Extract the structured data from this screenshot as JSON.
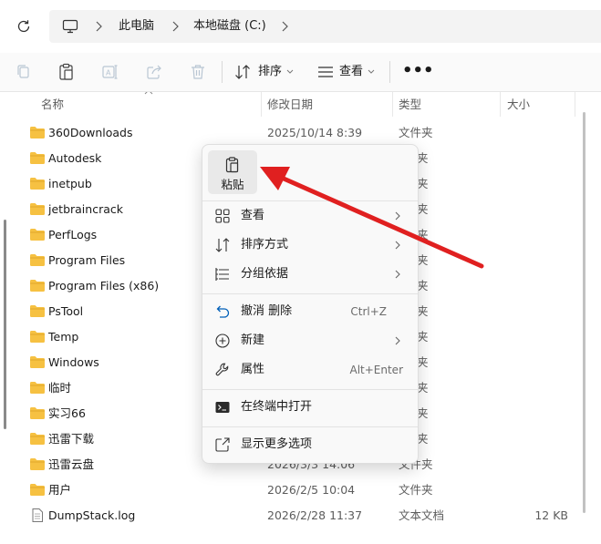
{
  "colors": {
    "folder": "#f6c142",
    "annotation_arrow": "#e02020",
    "accent": "#005fb8"
  },
  "breadcrumb": {
    "items": [
      "此电脑",
      "本地磁盘 (C:)"
    ]
  },
  "toolbar": {
    "sort_label": "排序",
    "view_label": "查看",
    "more_label": "•••"
  },
  "columns": {
    "name": "名称",
    "date": "修改日期",
    "type": "类型",
    "size": "大小"
  },
  "files": [
    {
      "name": "360Downloads",
      "date": "2025/10/14 8:39",
      "type": "文件夹",
      "size": "",
      "icon": "folder-icon"
    },
    {
      "name": "Autodesk",
      "date": "",
      "type": "夹",
      "size": "",
      "icon": "folder-icon"
    },
    {
      "name": "inetpub",
      "date": "",
      "type": "夹",
      "size": "",
      "icon": "folder-icon"
    },
    {
      "name": "jetbraincrack",
      "date": "",
      "type": "夹",
      "size": "",
      "icon": "folder-icon"
    },
    {
      "name": "PerfLogs",
      "date": "",
      "type": "夹",
      "size": "",
      "icon": "folder-icon"
    },
    {
      "name": "Program Files",
      "date": "",
      "type": "夹",
      "size": "",
      "icon": "folder-icon"
    },
    {
      "name": "Program Files (x86)",
      "date": "",
      "type": "夹",
      "size": "",
      "icon": "folder-icon"
    },
    {
      "name": "PsTool",
      "date": "",
      "type": "夹",
      "size": "",
      "icon": "folder-icon"
    },
    {
      "name": "Temp",
      "date": "",
      "type": "夹",
      "size": "",
      "icon": "folder-icon"
    },
    {
      "name": "Windows",
      "date": "",
      "type": "夹",
      "size": "",
      "icon": "folder-icon"
    },
    {
      "name": "临时",
      "date": "",
      "type": "夹",
      "size": "",
      "icon": "folder-icon"
    },
    {
      "name": "实习66",
      "date": "",
      "type": "夹",
      "size": "",
      "icon": "folder-icon"
    },
    {
      "name": "迅雷下载",
      "date": "",
      "type": "夹",
      "size": "",
      "icon": "folder-icon"
    },
    {
      "name": "迅雷云盘",
      "date": "2026/3/3 14:06",
      "type": "文件夹",
      "size": "",
      "icon": "folder-icon"
    },
    {
      "name": "用户",
      "date": "2026/2/5 10:04",
      "type": "文件夹",
      "size": "",
      "icon": "folder-icon"
    },
    {
      "name": "DumpStack.log",
      "date": "2026/2/28 11:37",
      "type": "文本文档",
      "size": "12 KB",
      "icon": "text-file-icon"
    }
  ],
  "context_menu": {
    "paste_label": "粘贴",
    "items": [
      {
        "label": "查看",
        "shortcut": "",
        "submenu": true,
        "icon": "grid-view-icon"
      },
      {
        "label": "排序方式",
        "shortcut": "",
        "submenu": true,
        "icon": "sort-icon"
      },
      {
        "label": "分组依据",
        "shortcut": "",
        "submenu": true,
        "icon": "group-by-icon"
      },
      {
        "label": "撤消 删除",
        "shortcut": "Ctrl+Z",
        "submenu": false,
        "icon": "undo-icon"
      },
      {
        "label": "新建",
        "shortcut": "",
        "submenu": true,
        "icon": "new-plus-icon"
      },
      {
        "label": "属性",
        "shortcut": "Alt+Enter",
        "submenu": false,
        "icon": "wrench-icon"
      },
      {
        "label": "在终端中打开",
        "shortcut": "",
        "submenu": false,
        "icon": "terminal-icon"
      },
      {
        "label": "显示更多选项",
        "shortcut": "",
        "submenu": false,
        "icon": "more-options-icon"
      }
    ]
  }
}
